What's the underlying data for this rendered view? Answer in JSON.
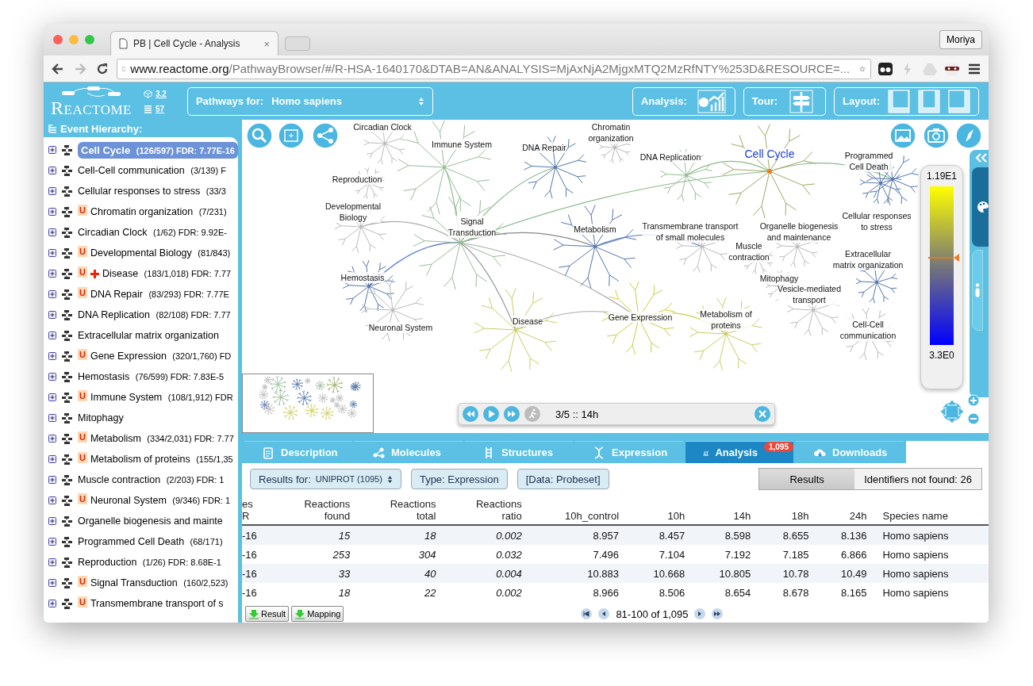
{
  "browser": {
    "tab_title": "PB | Cell Cycle - Analysis",
    "tab_close": "×",
    "profile": "Moriya",
    "url_host": "www.reactome.org",
    "url_path": "/PathwayBrowser/#/R-HSA-1640170&DTAB=AN&ANALYSIS=MjAxNjA2MjgxMTQ2MzRfNTY%253D&RESOURCE=..."
  },
  "header": {
    "logo": "REACTOME",
    "version": "3.2",
    "db_count": "57",
    "species_label": "Pathways for:",
    "species": "Homo sapiens",
    "analysis_label": "Analysis:",
    "tour_label": "Tour:",
    "layout_label": "Layout:"
  },
  "sidebar": {
    "title": "Event Hierarchy:",
    "items": [
      {
        "name": "Cell Cycle",
        "stats": "(126/597) FDR: 7.77E-16",
        "selected": true
      },
      {
        "name": "Cell-Cell communication",
        "stats": "(3/139) F",
        "selected": false
      },
      {
        "name": "Cellular responses to stress",
        "stats": "(33/3",
        "selected": false
      },
      {
        "name": "Chromatin organization",
        "stats": "(7/231)",
        "badge": "U",
        "selected": false
      },
      {
        "name": "Circadian Clock",
        "stats": "(1/62) FDR: 9.92E-",
        "selected": false
      },
      {
        "name": "Developmental Biology",
        "stats": "(81/843)",
        "badge": "U",
        "selected": false
      },
      {
        "name": "Disease",
        "stats": "(183/1,018) FDR: 7.77",
        "badge": "U",
        "disease": true,
        "selected": false
      },
      {
        "name": "DNA Repair",
        "stats": "(83/293) FDR: 7.77E",
        "badge": "U",
        "selected": false
      },
      {
        "name": "DNA Replication",
        "stats": "(82/108) FDR: 7.77",
        "selected": false
      },
      {
        "name": "Extracellular matrix organization",
        "selected": false
      },
      {
        "name": "Gene Expression",
        "stats": "(320/1,760) FD",
        "badge": "U",
        "selected": false
      },
      {
        "name": "Hemostasis",
        "stats": "(76/599) FDR: 7.83E-5",
        "selected": false
      },
      {
        "name": "Immune System",
        "stats": "(108/1,912) FDR",
        "badge": "U",
        "selected": false
      },
      {
        "name": "Mitophagy",
        "selected": false
      },
      {
        "name": "Metabolism",
        "stats": "(334/2,031) FDR: 7.77",
        "badge": "U",
        "selected": false
      },
      {
        "name": "Metabolism of proteins",
        "stats": "(155/1,35",
        "badge": "U",
        "selected": false
      },
      {
        "name": "Muscle contraction",
        "stats": "(2/203) FDR: 1",
        "selected": false
      },
      {
        "name": "Neuronal System",
        "stats": "(9/346) FDR: 1",
        "badge": "U",
        "selected": false
      },
      {
        "name": "Organelle biogenesis and mainte",
        "selected": false
      },
      {
        "name": "Programmed Cell Death",
        "stats": "(68/171)",
        "selected": false
      },
      {
        "name": "Reproduction",
        "stats": "(1/26) FDR: 8.68E-1",
        "selected": false
      },
      {
        "name": "Signal Transduction",
        "stats": "(160/2,523)",
        "badge": "U",
        "selected": false
      },
      {
        "name": "Transmembrane transport of s",
        "badge": "U",
        "selected": false
      }
    ]
  },
  "diagram": {
    "labels": [
      {
        "text": "Circadian Clock",
        "selected": false
      },
      {
        "text": "Immune System",
        "selected": false
      },
      {
        "text": "DNA Repair",
        "selected": false
      },
      {
        "text": "Chromatin\norganization",
        "selected": false
      },
      {
        "text": "DNA Replication",
        "selected": false
      },
      {
        "text": "Cell Cycle",
        "selected": true
      },
      {
        "text": "Programmed\nCell Death",
        "selected": false
      },
      {
        "text": "Reproduction",
        "selected": false
      },
      {
        "text": "Developmental\nBiology",
        "selected": false
      },
      {
        "text": "Signal\nTransduction",
        "selected": false
      },
      {
        "text": "Metabolism",
        "selected": false
      },
      {
        "text": "Transmembrane transport\nof small molecules",
        "selected": false
      },
      {
        "text": "Muscle\ncontraction",
        "selected": false
      },
      {
        "text": "Organelle biogenesis\nand maintenance",
        "selected": false
      },
      {
        "text": "Cellular responses\nto stress",
        "selected": false
      },
      {
        "text": "Extracellular\nmatrix organization",
        "selected": false
      },
      {
        "text": "Hemostasis",
        "selected": false
      },
      {
        "text": "Mitophagy",
        "selected": false
      },
      {
        "text": "Vesicle-mediated\ntransport",
        "selected": false
      },
      {
        "text": "Neuronal System",
        "selected": false
      },
      {
        "text": "Disease",
        "selected": false
      },
      {
        "text": "Gene Expression",
        "selected": false
      },
      {
        "text": "Metabolism of\nproteins",
        "selected": false
      },
      {
        "text": "Cell-Cell\ncommunication",
        "selected": false
      }
    ],
    "legend": {
      "max": "1.19E1",
      "min": "3.3E0",
      "level": 0.55
    },
    "player": {
      "text": "3/5 :: 14h"
    }
  },
  "details": {
    "tabs": [
      {
        "label": "Description",
        "selected": false
      },
      {
        "label": "Molecules",
        "selected": false
      },
      {
        "label": "Structures",
        "selected": false
      },
      {
        "label": "Expression",
        "selected": false
      },
      {
        "label": "Analysis",
        "selected": true,
        "badge": "1,095"
      },
      {
        "label": "Downloads",
        "selected": false
      }
    ],
    "results_for_label": "Results for:",
    "resource": "UNIPROT (1095)",
    "type": "Type: Expression",
    "data": "[Data: Probeset]",
    "views": [
      {
        "label": "Results",
        "selected": true
      },
      {
        "label": "Identifiers not found: 26",
        "selected": false
      }
    ],
    "table": {
      "columns": [
        "es\nR",
        "Reactions\nfound",
        "Reactions\ntotal",
        "Reactions\nratio",
        "10h_control",
        "10h",
        "14h",
        "18h",
        "24h",
        "Species name"
      ],
      "rows": [
        [
          "-16",
          "15",
          "18",
          "0.002",
          "8.957",
          "8.457",
          "8.598",
          "8.655",
          "8.136",
          "Homo sapiens"
        ],
        [
          "-16",
          "253",
          "304",
          "0.032",
          "7.496",
          "7.104",
          "7.192",
          "7.185",
          "6.866",
          "Homo sapiens"
        ],
        [
          "-16",
          "33",
          "40",
          "0.004",
          "10.883",
          "10.668",
          "10.805",
          "10.78",
          "10.49",
          "Homo sapiens"
        ],
        [
          "-16",
          "18",
          "22",
          "0.002",
          "8.966",
          "8.506",
          "8.654",
          "8.678",
          "8.165",
          "Homo sapiens"
        ]
      ]
    },
    "downloads": [
      "Result",
      "Mapping"
    ],
    "pager": "81-100 of 1,095"
  }
}
